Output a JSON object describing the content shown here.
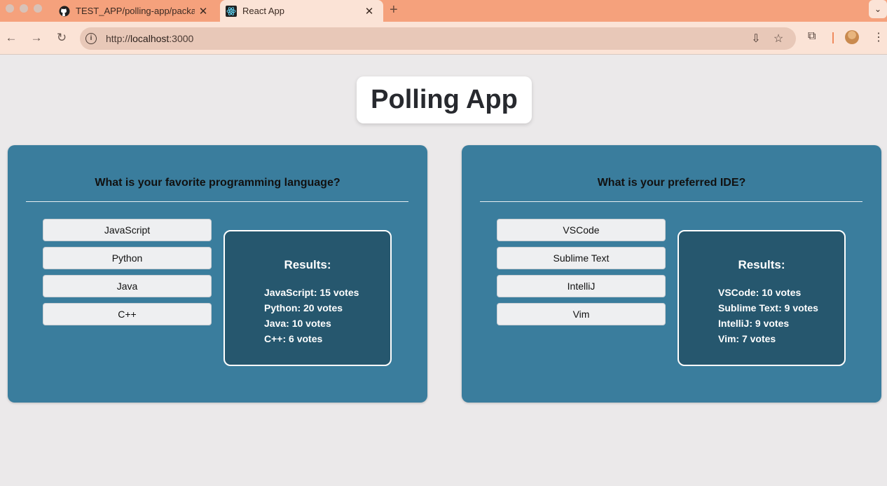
{
  "browser": {
    "tabs": [
      {
        "title": "TEST_APP/polling-app/package",
        "favicon": "github-icon",
        "active": false
      },
      {
        "title": "React App",
        "favicon": "react-icon",
        "active": true
      }
    ],
    "url": {
      "scheme": "http://",
      "host": "localhost",
      "port": ":3000"
    }
  },
  "page": {
    "title": "Polling App",
    "polls": [
      {
        "question": "What is your favorite programming language?",
        "options": [
          "JavaScript",
          "Python",
          "Java",
          "C++"
        ],
        "results_title": "Results:",
        "results": [
          "JavaScript: 15 votes",
          "Python: 20 votes",
          "Java: 10 votes",
          "C++: 6 votes"
        ]
      },
      {
        "question": "What is your preferred IDE?",
        "options": [
          "VSCode",
          "Sublime Text",
          "IntelliJ",
          "Vim"
        ],
        "results_title": "Results:",
        "results": [
          "VSCode: 10 votes",
          "Sublime Text: 9 votes",
          "IntelliJ: 9 votes",
          "Vim: 7 votes"
        ]
      }
    ]
  },
  "colors": {
    "tabbar": "#f5a17c",
    "poll_card": "#3a7d9d",
    "results_box": "#26576e",
    "page_bg": "#ebe9ea"
  }
}
